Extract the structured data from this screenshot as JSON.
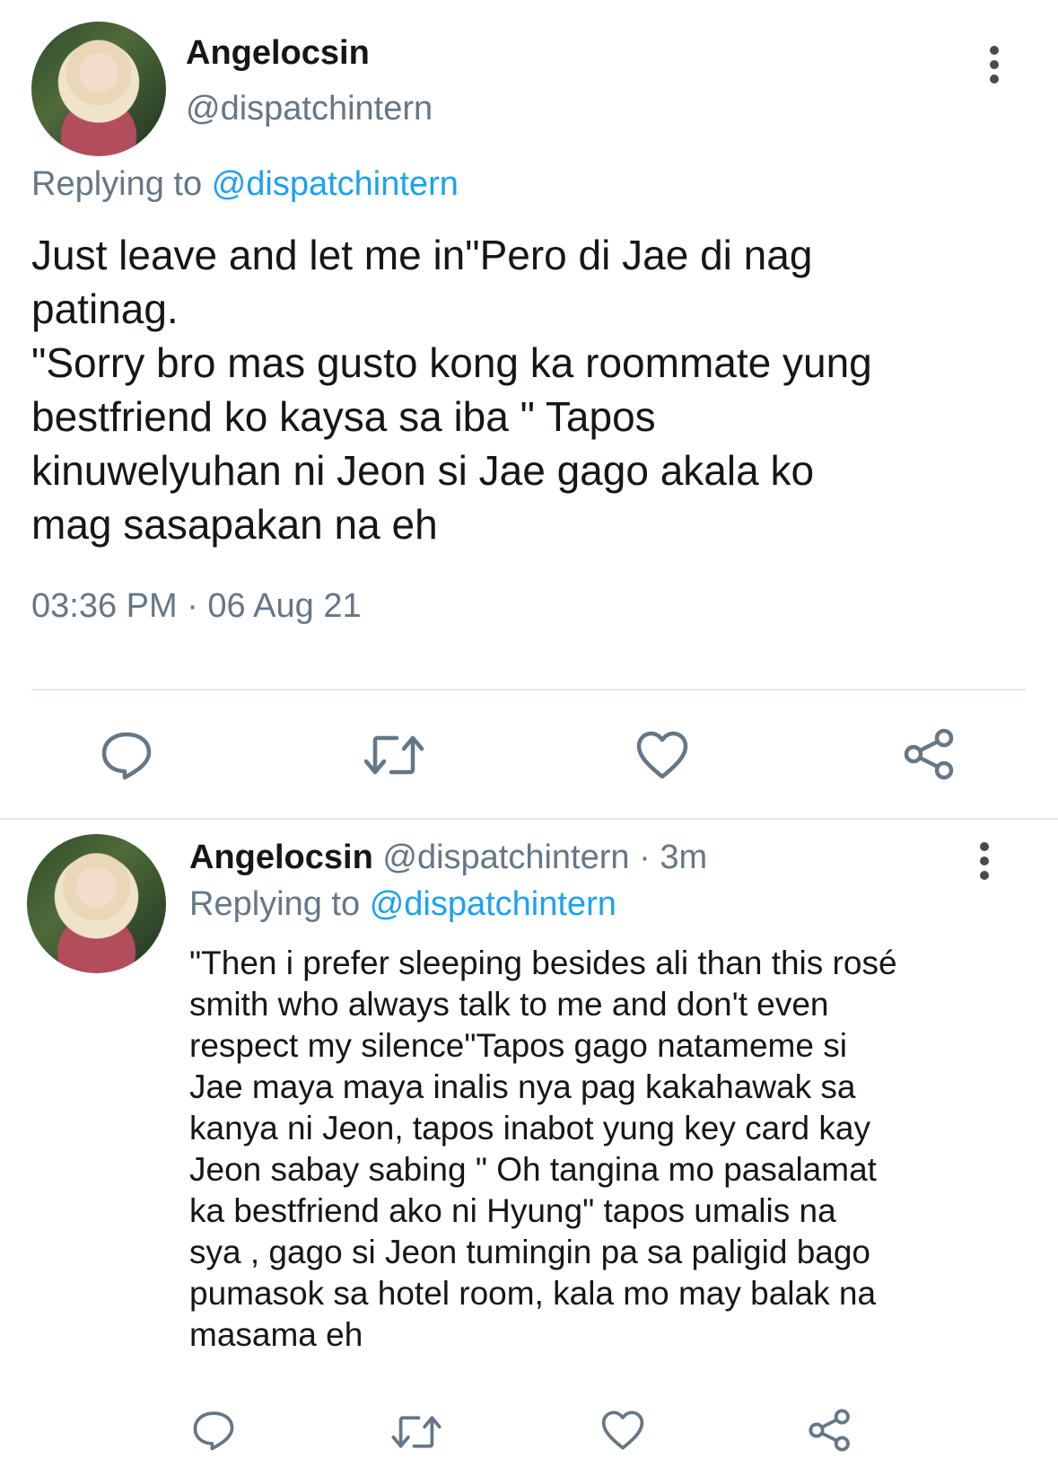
{
  "main_tweet": {
    "display_name": "Angelocsin",
    "handle": "@dispatchintern",
    "replying_prefix": "Replying to",
    "replying_to": "@dispatchintern",
    "text": "Just leave and let me in\"Pero di Jae di nag\npatinag.\n\"Sorry bro mas gusto kong ka roommate yung\nbestfriend ko kaysa sa iba \" Tapos\nkinuwelyuhan ni Jeon si Jae gago akala ko\nmag sasapakan na eh",
    "timestamp": "03:36 PM · 06 Aug 21",
    "actions": [
      "reply-icon",
      "retweet-icon",
      "like-icon",
      "share-icon"
    ]
  },
  "reply_tweet": {
    "display_name": "Angelocsin",
    "handle": "@dispatchintern",
    "time_ago": "· 3m",
    "replying_prefix": "Replying to",
    "replying_to": "@dispatchintern",
    "text": "\"Then i prefer sleeping besides ali than this rosé\nsmith who always talk to me and don't even\nrespect my silence\"Tapos gago natameme si\nJae maya maya inalis nya pag kakahawak sa\nkanya ni Jeon, tapos inabot yung key card kay\nJeon sabay sabing \" Oh tangina mo pasalamat\nka bestfriend ako ni Hyung\" tapos umalis na\nsya , gago si Jeon tumingin pa sa paligid bago\npumasok sa hotel room, kala mo may balak na\nmasama eh",
    "actions": [
      "reply-icon",
      "retweet-icon",
      "like-icon",
      "share-icon"
    ]
  },
  "colors": {
    "link": "#1da1f2",
    "muted": "#657786",
    "icon": "#657786",
    "divider": "#e1e8ed"
  }
}
